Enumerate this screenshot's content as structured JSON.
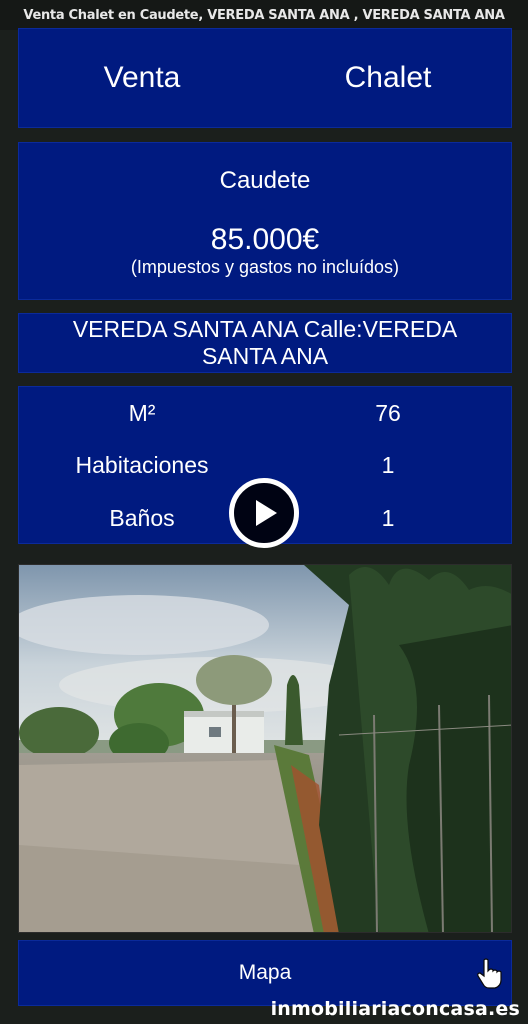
{
  "header": {
    "title": "Venta Chalet en Caudete, VEREDA SANTA ANA , VEREDA SANTA ANA"
  },
  "summary": {
    "operation": "Venta",
    "property_type": "Chalet"
  },
  "pricing": {
    "city": "Caudete",
    "price": "85.000€",
    "note": "(Impuestos y gastos no incluídos)"
  },
  "address": {
    "text": "VEREDA SANTA ANA  Calle:VEREDA SANTA ANA"
  },
  "features": [
    {
      "label": "M²",
      "value": "76"
    },
    {
      "label": "Habitaciones",
      "value": "1"
    },
    {
      "label": "Baños",
      "value": "1"
    }
  ],
  "media": {
    "play_icon": "play-icon",
    "photo": "property-photo"
  },
  "map": {
    "label": "Mapa",
    "icon": "pointer-hand-icon"
  },
  "brand": {
    "text": "inmobiliariaconcasa.es"
  }
}
